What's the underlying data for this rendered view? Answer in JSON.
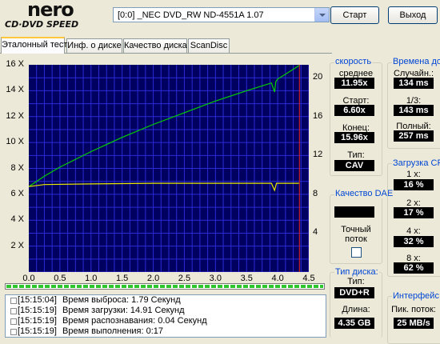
{
  "logo": {
    "brand": "nero",
    "product": "CD·DVD SPEED"
  },
  "drive": {
    "selected": "[0:0]  _NEC DVD_RW ND-4551A 1.07"
  },
  "buttons": {
    "start": "Старт",
    "exit": "Выход"
  },
  "tabs": [
    {
      "label": "Эталонный тест",
      "active": true
    },
    {
      "label": "Инф. о диске",
      "active": false
    },
    {
      "label": "Качество диска",
      "active": false
    },
    {
      "label": "ScanDisc",
      "active": false
    }
  ],
  "chart_data": {
    "type": "line",
    "xlim": [
      0,
      4.5
    ],
    "ylim": [
      0,
      16
    ],
    "y2lim": [
      0,
      21.33
    ],
    "x_ticks": [
      "0.0",
      "0.5",
      "1.0",
      "1.5",
      "2.0",
      "2.5",
      "3.0",
      "3.5",
      "4.0",
      "4.5"
    ],
    "y_ticks": [
      "16 X",
      "14 X",
      "12 X",
      "10 X",
      "8 X",
      "6 X",
      "4 X",
      "2 X"
    ],
    "y2_ticks": [
      "20",
      "16",
      "12",
      "8",
      "4"
    ],
    "series": [
      {
        "color": "#00d000",
        "x": [
          0,
          0.25,
          0.5,
          1.0,
          1.5,
          2.0,
          2.5,
          3.0,
          3.5,
          3.9,
          3.95,
          3.97,
          4.0,
          4.1,
          4.35
        ],
        "y": [
          6.6,
          7.4,
          8.1,
          9.3,
          10.4,
          11.4,
          12.3,
          13.2,
          14.0,
          14.6,
          13.9,
          14.7,
          14.9,
          15.2,
          15.96
        ]
      },
      {
        "color": "#e8e800",
        "x": [
          0,
          0.25,
          1.0,
          2.0,
          3.0,
          3.9,
          3.95,
          3.98,
          4.0,
          4.35
        ],
        "y": [
          6.6,
          6.75,
          6.8,
          6.85,
          6.85,
          6.85,
          6.3,
          6.85,
          6.85,
          6.85
        ]
      }
    ],
    "marker_x": 4.35,
    "marker_color": "#c02020",
    "grid": true
  },
  "progress": {
    "fraction": 1.0
  },
  "log": [
    {
      "time": "[15:15:04]",
      "message": "Время выброса: 1.79 Секунд"
    },
    {
      "time": "[15:15:19]",
      "message": "Время загрузки: 14.91 Секунд"
    },
    {
      "time": "[15:15:19]",
      "message": "Время распознавания: 0.04 Секунд"
    },
    {
      "time": "[15:15:19]",
      "message": "Время выполнения:  0:17"
    }
  ],
  "speed": {
    "title": "скорость",
    "avg_label": "среднее",
    "avg": "11.95x",
    "start_label": "Старт:",
    "start": "6.60x",
    "end_label": "Конец:",
    "end": "15.96x",
    "type_label": "Тип:",
    "type": "CAV"
  },
  "access": {
    "title": "Времена дос",
    "random_label": "Случайн.:",
    "random": "134 ms",
    "third_label": "1/3:",
    "third": "143 ms",
    "full_label": "Полный:",
    "full": "257 ms"
  },
  "cpu": {
    "title": "Загрузка CPI",
    "items": [
      {
        "label": "1 x:",
        "value": "16 %"
      },
      {
        "label": "2 x:",
        "value": "17 %"
      },
      {
        "label": "4 x:",
        "value": "32 %"
      },
      {
        "label": "8 x:",
        "value": "62 %"
      }
    ]
  },
  "dae": {
    "title": "Качество DAE",
    "value": "",
    "accurate_label": "Точный\nпоток"
  },
  "disc": {
    "title": "Тип диска:",
    "type_label": "Тип:",
    "type": "DVD+R",
    "length_label": "Длина:",
    "length": "4.35 GB"
  },
  "interface": {
    "title": "Интерфейс",
    "burst_label": "Пик. поток:",
    "burst": "25 MB/s"
  }
}
